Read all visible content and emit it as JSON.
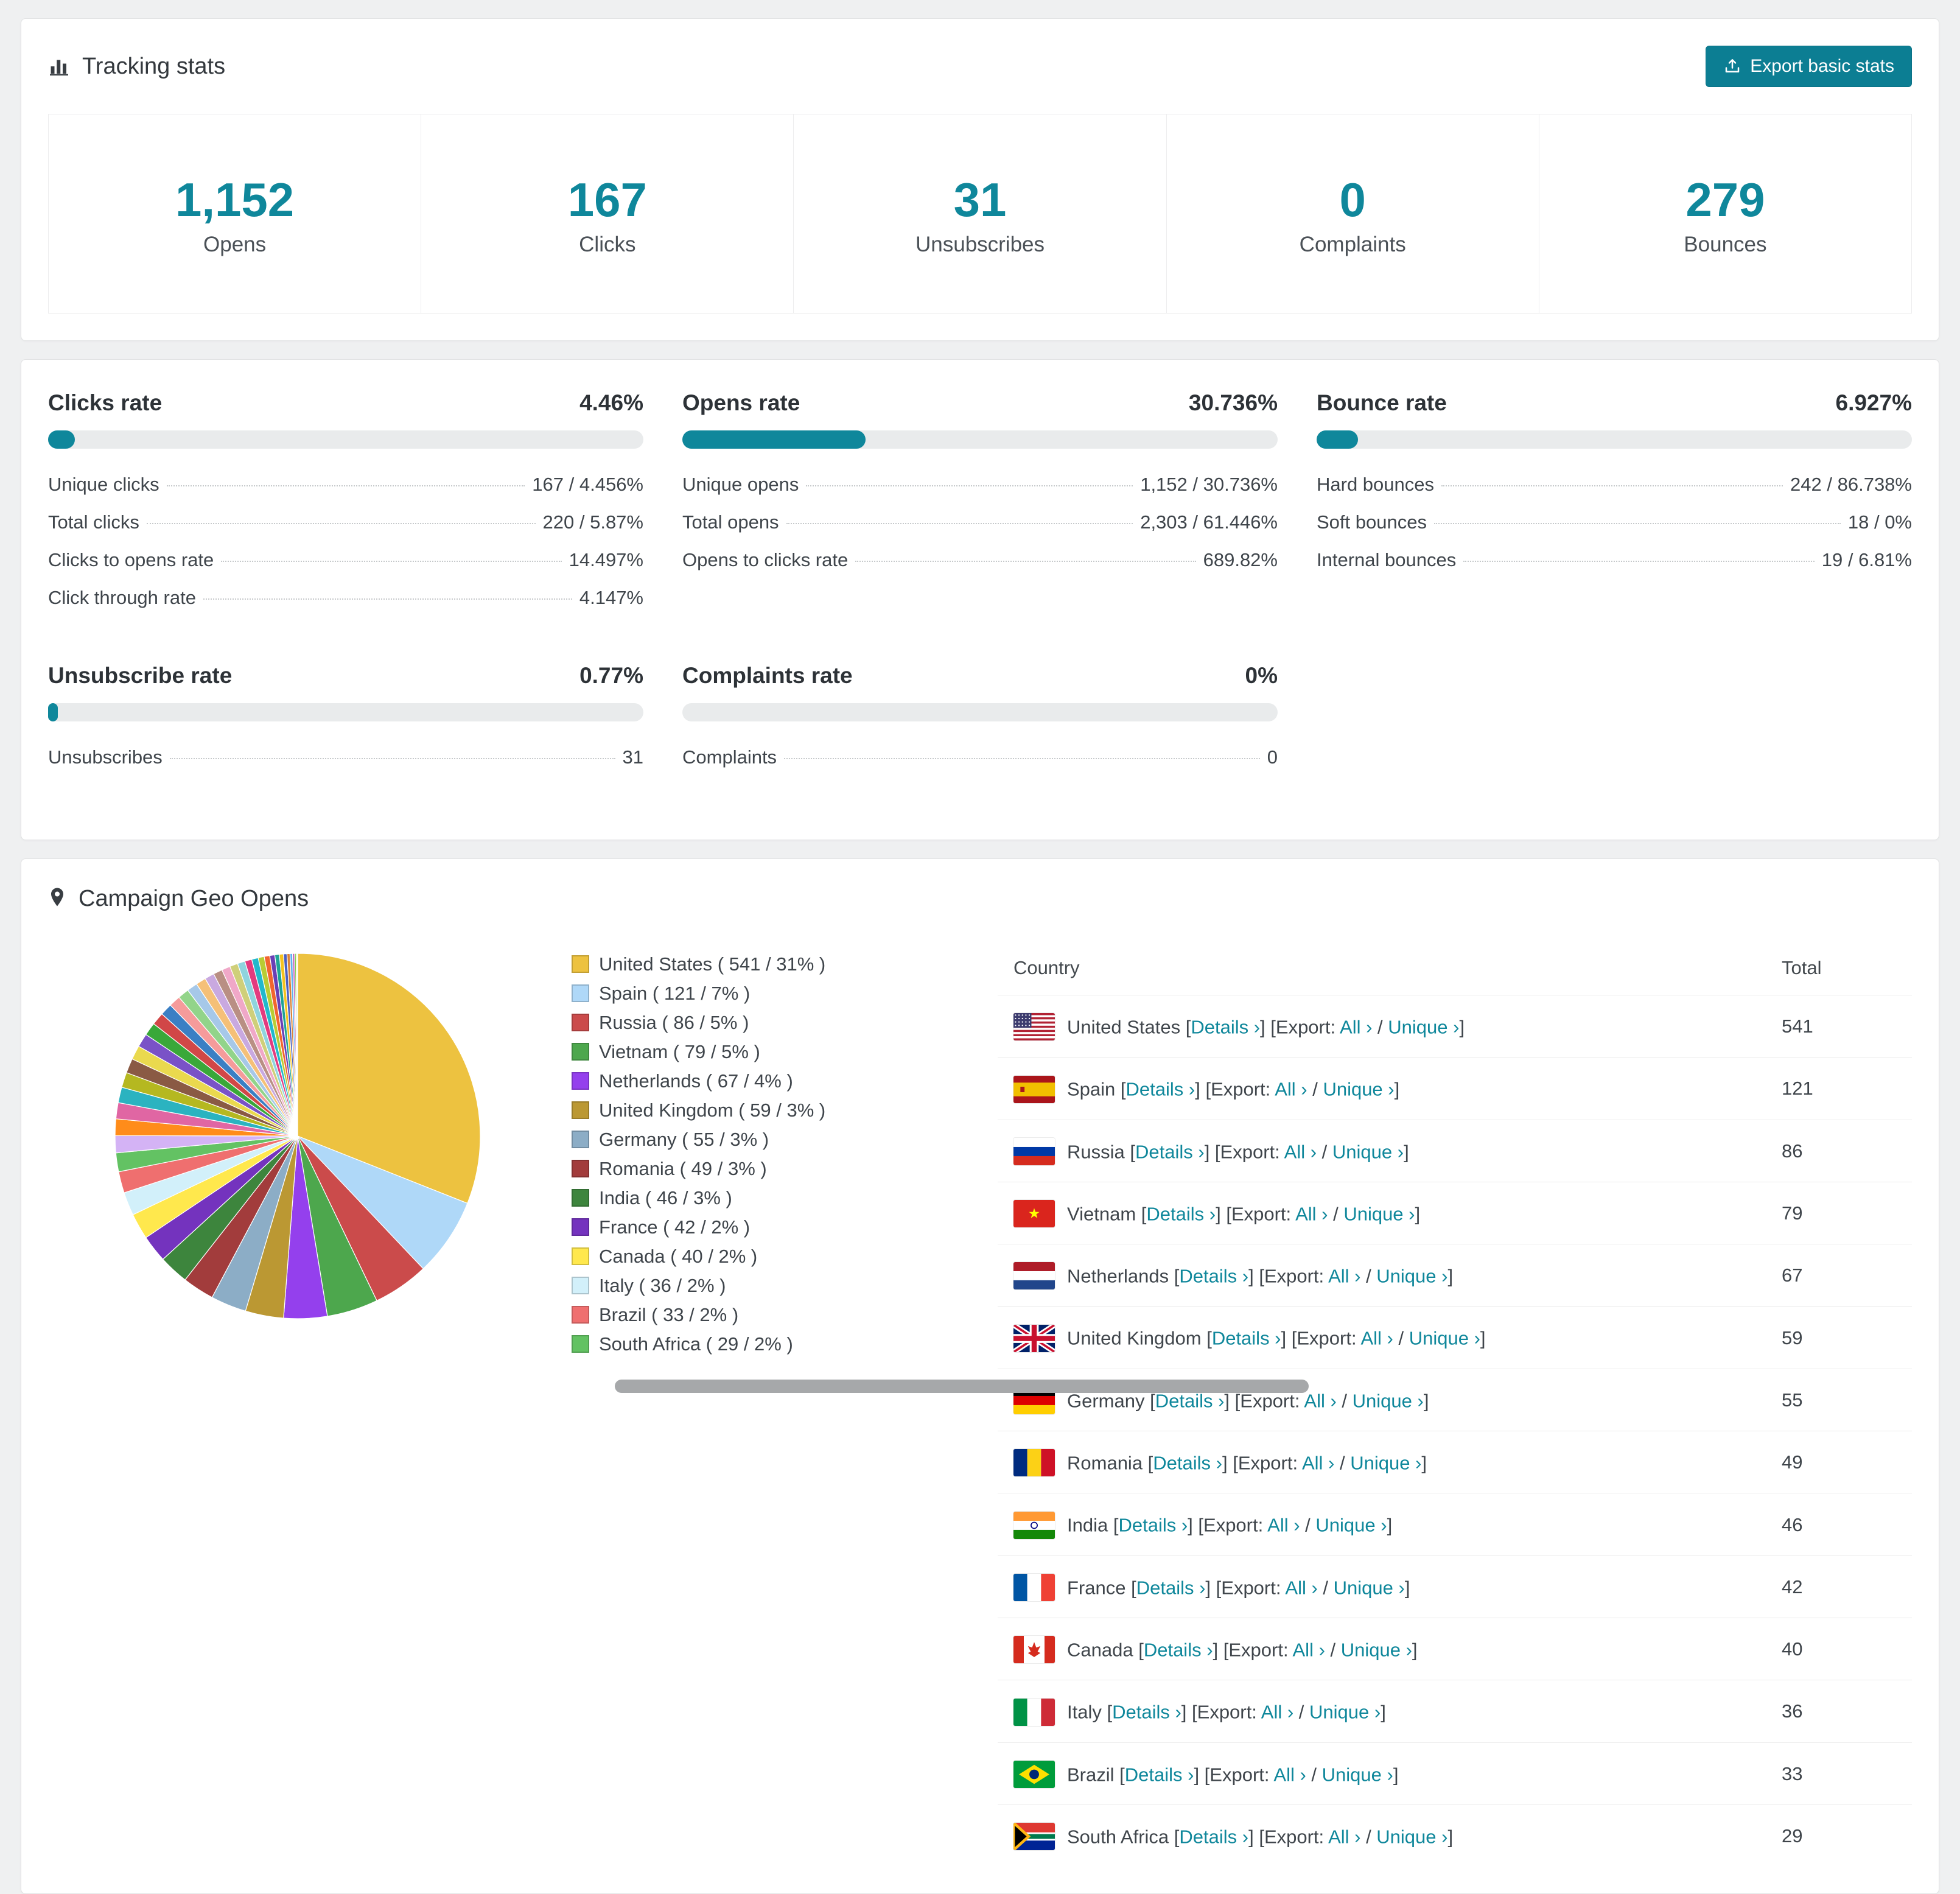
{
  "colors": {
    "accent": "#0f879b",
    "button": "#0c7e93",
    "bar_track": "#e9ebec",
    "page_bg": "#eff0f1"
  },
  "tracking": {
    "title": "Tracking stats",
    "export_button": "Export basic stats",
    "stats": [
      {
        "value": "1,152",
        "label": "Opens"
      },
      {
        "value": "167",
        "label": "Clicks"
      },
      {
        "value": "31",
        "label": "Unsubscribes"
      },
      {
        "value": "0",
        "label": "Complaints"
      },
      {
        "value": "279",
        "label": "Bounces"
      }
    ]
  },
  "rates": [
    {
      "title": "Clicks rate",
      "value": "4.46%",
      "pct": 4.46,
      "rows": [
        {
          "label": "Unique clicks",
          "value": "167 / 4.456%"
        },
        {
          "label": "Total clicks",
          "value": "220 / 5.87%"
        },
        {
          "label": "Clicks to opens rate",
          "value": "14.497%"
        },
        {
          "label": "Click through rate",
          "value": "4.147%"
        }
      ]
    },
    {
      "title": "Opens rate",
      "value": "30.736%",
      "pct": 30.736,
      "rows": [
        {
          "label": "Unique opens",
          "value": "1,152 / 30.736%"
        },
        {
          "label": "Total opens",
          "value": "2,303 / 61.446%"
        },
        {
          "label": "Opens to clicks rate",
          "value": "689.82%"
        }
      ]
    },
    {
      "title": "Bounce rate",
      "value": "6.927%",
      "pct": 6.927,
      "rows": [
        {
          "label": "Hard bounces",
          "value": "242 / 86.738%"
        },
        {
          "label": "Soft bounces",
          "value": "18 / 0%"
        },
        {
          "label": "Internal bounces",
          "value": "19 / 6.81%"
        }
      ]
    },
    {
      "title": "Unsubscribe rate",
      "value": "0.77%",
      "pct": 0.77,
      "rows": [
        {
          "label": "Unsubscribes",
          "value": "31"
        }
      ]
    },
    {
      "title": "Complaints rate",
      "value": "0%",
      "pct": 0,
      "rows": [
        {
          "label": "Complaints",
          "value": "0"
        }
      ]
    }
  ],
  "geo": {
    "title": "Campaign Geo Opens",
    "table": {
      "country_header": "Country",
      "total_header": "Total",
      "links": {
        "details": "Details ›",
        "export_prefix": "Export:",
        "all": "All ›",
        "unique": "Unique ›"
      }
    }
  },
  "chart_data": {
    "type": "pie",
    "title": "Campaign Geo Opens",
    "unit": "opens",
    "legend_position": "right",
    "slices": [
      {
        "label": "United States",
        "value": 541,
        "pct": 31,
        "color": "#edc240",
        "flag": "us"
      },
      {
        "label": "Spain",
        "value": 121,
        "pct": 7,
        "color": "#afd8f8",
        "flag": "es"
      },
      {
        "label": "Russia",
        "value": 86,
        "pct": 5,
        "color": "#cb4b4b",
        "flag": "ru"
      },
      {
        "label": "Vietnam",
        "value": 79,
        "pct": 5,
        "color": "#4da74d",
        "flag": "vn"
      },
      {
        "label": "Netherlands",
        "value": 67,
        "pct": 4,
        "color": "#9440ed",
        "flag": "nl"
      },
      {
        "label": "United Kingdom",
        "value": 59,
        "pct": 3,
        "color": "#bb9833",
        "flag": "gb"
      },
      {
        "label": "Germany",
        "value": 55,
        "pct": 3,
        "color": "#8cadc6",
        "flag": "de"
      },
      {
        "label": "Romania",
        "value": 49,
        "pct": 3,
        "color": "#a23c3c",
        "flag": "ro"
      },
      {
        "label": "India",
        "value": 46,
        "pct": 3,
        "color": "#3d853d",
        "flag": "in"
      },
      {
        "label": "France",
        "value": 42,
        "pct": 2,
        "color": "#7433be",
        "flag": "fr"
      },
      {
        "label": "Canada",
        "value": 40,
        "pct": 2,
        "color": "#ffe84d",
        "flag": "ca"
      },
      {
        "label": "Italy",
        "value": 36,
        "pct": 2,
        "color": "#d2f0fa",
        "flag": "it"
      },
      {
        "label": "Brazil",
        "value": 33,
        "pct": 2,
        "color": "#ef6f6f",
        "flag": "br"
      },
      {
        "label": "South Africa",
        "value": 29,
        "pct": 2,
        "color": "#63c263",
        "flag": "za"
      }
    ],
    "others_unlabeled": {
      "value": 462,
      "colors": [
        "#d4b3f5",
        "#ff8c1a",
        "#e066a3",
        "#2bb3c0",
        "#b5b820",
        "#8a5a44",
        "#ead94e",
        "#7a52c7",
        "#39a839",
        "#d14747",
        "#3b7fc4",
        "#f59b9b",
        "#92d48a",
        "#a6c8e8",
        "#f5c078",
        "#c9a9e0",
        "#b98f84",
        "#f0a8c8",
        "#cfcf7a",
        "#8fd4de",
        "#e33b7f",
        "#22b8cc",
        "#b9cc33",
        "#f2652e",
        "#6a3fb5",
        "#1fa396",
        "#f5c21f",
        "#4a5fc1",
        "#d98236",
        "#5fb0f0",
        "#c45ab3",
        "#7ccf4e",
        "#e8e84a",
        "#9e9e2e"
      ]
    }
  }
}
